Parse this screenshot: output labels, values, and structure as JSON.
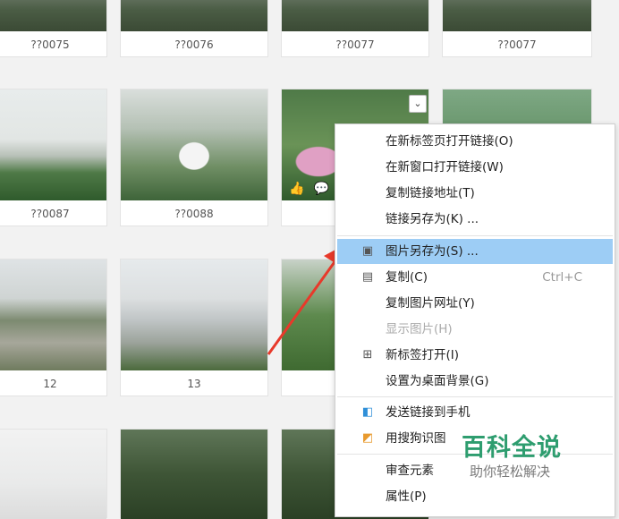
{
  "thumbnails": [
    {
      "caption": "??0075"
    },
    {
      "caption": "??0076"
    },
    {
      "caption": "??0077"
    },
    {
      "caption": "??0077"
    },
    {
      "caption": "??0087"
    },
    {
      "caption": "??0088"
    },
    {
      "caption": "12"
    },
    {
      "caption": "13"
    }
  ],
  "overlay": {
    "chevron_glyph": "⌄",
    "like_glyph": "👍",
    "comment_glyph": "💬"
  },
  "context_menu": {
    "items": [
      {
        "label": "在新标签页打开链接(O)"
      },
      {
        "label": "在新窗口打开链接(W)"
      },
      {
        "label": "复制链接地址(T)"
      },
      {
        "label": "链接另存为(K) ..."
      },
      {
        "label": "图片另存为(S) ...",
        "highlighted": true,
        "icon": "▣"
      },
      {
        "label": "复制(C)",
        "shortcut": "Ctrl+C",
        "icon": "▤"
      },
      {
        "label": "复制图片网址(Y)"
      },
      {
        "label": "显示图片(H)",
        "disabled": true
      },
      {
        "label": "新标签打开(I)",
        "icon": "⊞"
      },
      {
        "label": "设置为桌面背景(G)"
      },
      {
        "label": "发送链接到手机",
        "icon": "◧"
      },
      {
        "label": "用搜狗识图",
        "icon": "◩"
      },
      {
        "label": "审查元素"
      },
      {
        "label": "属性(P)"
      }
    ]
  },
  "watermark": {
    "title": "百科全说",
    "subtitle": "助你轻松解决"
  },
  "colors": {
    "highlight": "#9dcdf5",
    "arrow": "#e8392a",
    "watermark_green": "#2e9d6f"
  }
}
